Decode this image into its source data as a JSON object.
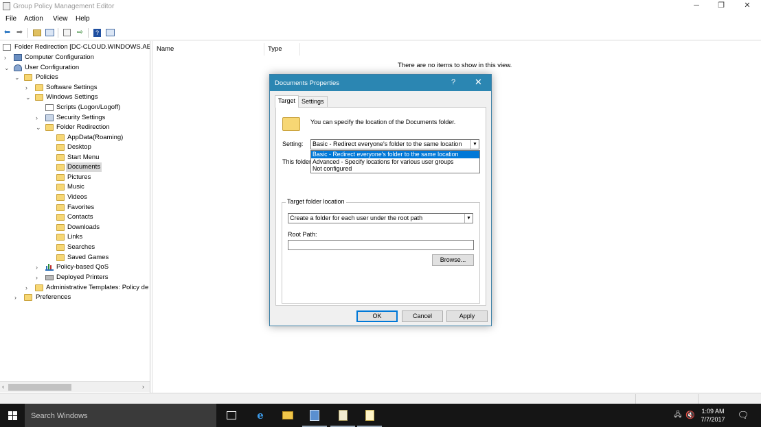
{
  "window": {
    "title": "Group Policy Management Editor",
    "controls": {
      "minimize": "─",
      "restore": "❐",
      "close": "✕"
    }
  },
  "menu": [
    "File",
    "Action",
    "View",
    "Help"
  ],
  "toolbar": {
    "icons": [
      "back-icon",
      "forward-icon",
      "up-icon",
      "show-hide-tree-icon",
      "properties-icon",
      "export-icon",
      "help-icon",
      "console-icon"
    ]
  },
  "tree": {
    "root": "Folder Redirection [DC-CLOUD.WINDOWS.AE",
    "computer_config": "Computer Configuration",
    "user_config": "User Configuration",
    "policies": "Policies",
    "software_settings": "Software Settings",
    "windows_settings": "Windows Settings",
    "scripts": "Scripts (Logon/Logoff)",
    "security_settings": "Security Settings",
    "folder_redirection": "Folder Redirection",
    "folders": [
      "AppData(Roaming)",
      "Desktop",
      "Start Menu",
      "Documents",
      "Pictures",
      "Music",
      "Videos",
      "Favorites",
      "Contacts",
      "Downloads",
      "Links",
      "Searches",
      "Saved Games"
    ],
    "selected": "Documents",
    "policy_qos": "Policy-based QoS",
    "deployed_printers": "Deployed Printers",
    "admin_templates": "Administrative Templates: Policy de",
    "preferences": "Preferences"
  },
  "list": {
    "columns": [
      "Name",
      "Type"
    ],
    "empty_message": "There are no items to show in this view."
  },
  "dialog": {
    "title": "Documents Properties",
    "help": "?",
    "close": "✕",
    "tabs": [
      "Target",
      "Settings"
    ],
    "active_tab": "Target",
    "intro": "You can specify the location of the Documents folder.",
    "setting_label": "Setting:",
    "setting_value": "Basic - Redirect everyone's folder to the same location",
    "setting_options": [
      "Basic - Redirect everyone's folder to the same location",
      "Advanced - Specify locations for various user groups",
      "Not configured"
    ],
    "this_folder_label": "This folder",
    "target_group_label": "Target folder location",
    "target_value": "Create a folder for each user under the root path",
    "root_path_label": "Root Path:",
    "root_path_value": "",
    "browse": "Browse...",
    "ok": "OK",
    "cancel": "Cancel",
    "apply": "Apply"
  },
  "taskbar": {
    "search_placeholder": "Search Windows",
    "time": "1:09 AM",
    "date": "7/7/2017"
  },
  "colors": {
    "dialog_title": "#2b86b2",
    "selection": "#0078d7",
    "taskbar": "#151515",
    "folder": "#f7d774"
  }
}
